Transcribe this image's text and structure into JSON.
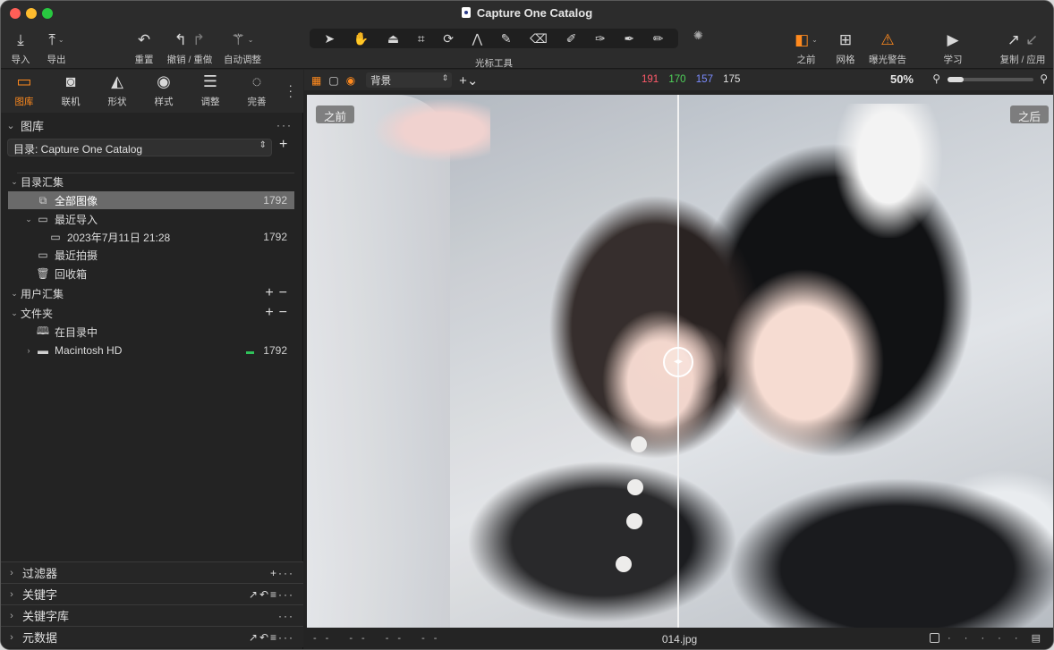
{
  "window": {
    "title": "Capture One Catalog"
  },
  "toolbar": {
    "import_label": "导入",
    "export_label": "导出",
    "reset_label": "重置",
    "undo_redo_label": "撤销 / 重做",
    "auto_adjust_label": "自动调整",
    "cursor_tools_label": "光标工具",
    "before_label": "之前",
    "grid_label": "网格",
    "exposure_warning_label": "曝光警告",
    "learn_label": "学习",
    "copy_apply_label": "复制 / 应用"
  },
  "tool_tabs": [
    {
      "label": "图库",
      "icon": "folder-icon",
      "active": true
    },
    {
      "label": "联机",
      "icon": "camera-icon",
      "active": false
    },
    {
      "label": "形状",
      "icon": "lens-icon",
      "active": false
    },
    {
      "label": "样式",
      "icon": "palette-icon",
      "active": false
    },
    {
      "label": "调整",
      "icon": "sliders-icon",
      "active": false
    },
    {
      "label": "完善",
      "icon": "circle-dashed-icon",
      "active": false
    }
  ],
  "library": {
    "section_title": "图库",
    "catalog_select": "目录: Capture One Catalog",
    "catalog_collections_label": "目录汇集",
    "all_images_label": "全部图像",
    "all_images_count": "1792",
    "recent_imports_label": "最近导入",
    "import_date_label": "2023年7月11日 21:28",
    "import_date_count": "1792",
    "recent_captures_label": "最近拍摄",
    "trash_label": "回收箱",
    "user_collections_label": "用户汇集",
    "folders_label": "文件夹",
    "in_catalog_label": "在目录中",
    "macintosh_hd_label": "Macintosh HD",
    "macintosh_hd_count": "1792"
  },
  "bottom_sections": [
    {
      "label": "过滤器"
    },
    {
      "label": "关键字"
    },
    {
      "label": "关键字库"
    },
    {
      "label": "元数据"
    }
  ],
  "viewer": {
    "background_select": "背景",
    "rgb": {
      "r": "191",
      "g": "170",
      "b": "157",
      "l": "175"
    },
    "zoom": "50%",
    "before_tag": "之前",
    "after_tag": "之后",
    "status_dashes": "-- -- -- --",
    "filename": "014.jpg"
  },
  "colors": {
    "accent": "#ff8a1e",
    "rgb_r": "#ff5a6a",
    "rgb_g": "#4fd15a",
    "rgb_b": "#7b8cff",
    "rgb_l": "#e0e0e0"
  }
}
